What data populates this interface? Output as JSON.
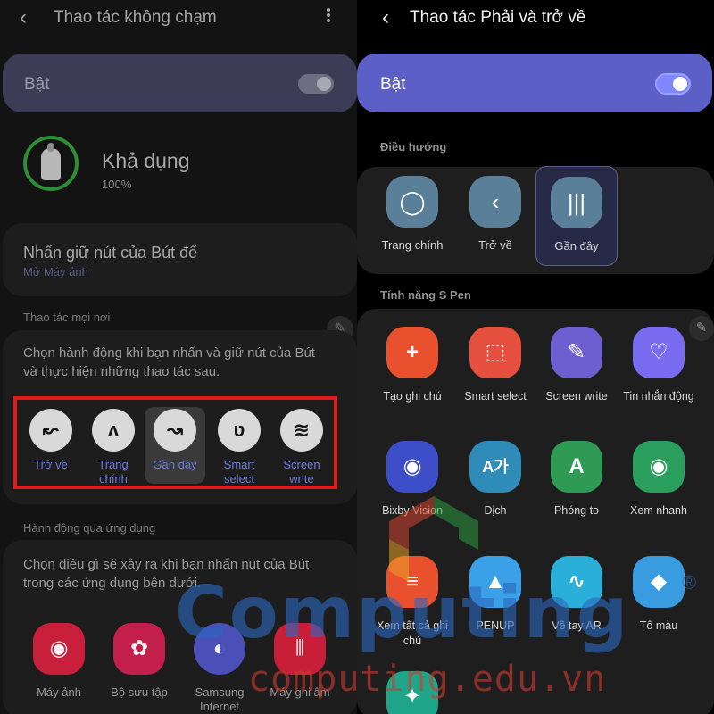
{
  "left_screen": {
    "title": "Thao tác không chạm",
    "toggle_label": "Bật",
    "battery": {
      "status": "Khả dụng",
      "percent": "100%"
    },
    "press_hold": {
      "title": "Nhấn giữ nút của Bút để",
      "value": "Mở Máy ảnh"
    },
    "section_anywhere": "Thao tác mọi nơi",
    "anywhere_desc": "Chọn hành động khi bạn nhấn và giữ nút của Bút và thực hiện những thao tác sau.",
    "gestures": [
      {
        "label": "Trở về",
        "icon": "gesture-back-icon",
        "glyph": "↜"
      },
      {
        "label": "Trang chính",
        "icon": "gesture-home-icon",
        "glyph": "ʌ"
      },
      {
        "label": "Gần đây",
        "icon": "gesture-recent-icon",
        "glyph": "↝"
      },
      {
        "label": "Smart select",
        "icon": "gesture-smart-select-icon",
        "glyph": "ʋ"
      },
      {
        "label": "Screen write",
        "icon": "gesture-screen-write-icon",
        "glyph": "≋"
      }
    ],
    "selected_gesture": "Gần đây",
    "section_app": "Hành động qua ứng dụng",
    "app_desc": "Chọn điều gì sẽ xảy ra khi bạn nhấn nút của Bút trong các ứng dụng bên dưới.",
    "apps": [
      {
        "label": "Máy ảnh",
        "icon": "camera-icon",
        "color": "#c8203b"
      },
      {
        "label": "Bộ sưu tập",
        "icon": "gallery-icon",
        "color": "#c21f4d"
      },
      {
        "label": "Samsung Internet",
        "icon": "samsung-internet-icon",
        "color": "#4b4fb8"
      },
      {
        "label": "Máy ghi âm",
        "icon": "voice-recorder-icon",
        "color": "#c81e38"
      }
    ]
  },
  "right_screen": {
    "title": "Thao tác Phải và trở về",
    "toggle_label": "Bật",
    "section_navigation": "Điều hướng",
    "nav_items": [
      {
        "label": "Trang chính",
        "icon": "home-icon",
        "glyph": "◯"
      },
      {
        "label": "Trở về",
        "icon": "back-icon",
        "glyph": "‹"
      },
      {
        "label": "Gần đây",
        "icon": "recents-icon",
        "glyph": "|||"
      }
    ],
    "selected_nav": "Gần đây",
    "section_features": "Tính năng S Pen",
    "features": [
      {
        "label": "Tạo ghi chú",
        "icon": "create-note-icon",
        "color": "#e8502e",
        "glyph": "+"
      },
      {
        "label": "Smart select",
        "icon": "smart-select-icon",
        "color": "#e4503d",
        "glyph": "⬚"
      },
      {
        "label": "Screen write",
        "icon": "screen-write-icon",
        "color": "#6d5fd0",
        "glyph": "✎"
      },
      {
        "label": "Tin nhắn động",
        "icon": "live-message-icon",
        "color": "#7a6cf0",
        "glyph": "♡"
      },
      {
        "label": "Bixby Vision",
        "icon": "bixby-vision-icon",
        "color": "#3d4fc8",
        "glyph": "◉"
      },
      {
        "label": "Dịch",
        "icon": "translate-icon",
        "color": "#2f8bb8",
        "glyph": "A가"
      },
      {
        "label": "Phóng to",
        "icon": "magnify-icon",
        "color": "#2e9a54",
        "glyph": "A"
      },
      {
        "label": "Xem nhanh",
        "icon": "glance-icon",
        "color": "#2a9e5c",
        "glyph": "◉"
      },
      {
        "label": "Xem tất cả ghi chú",
        "icon": "view-all-notes-icon",
        "color": "#e8502e",
        "glyph": "≡"
      },
      {
        "label": "PENUP",
        "icon": "penup-icon",
        "color": "#3aa0e8",
        "glyph": "▲"
      },
      {
        "label": "Vẽ tay AR",
        "icon": "ar-doodle-icon",
        "color": "#2ab0d8",
        "glyph": "∿"
      },
      {
        "label": "Tô màu",
        "icon": "coloring-icon",
        "color": "#3a9ce0",
        "glyph": "◆"
      },
      {
        "label": "",
        "icon": "ar-emoji-icon",
        "color": "#1fa68a",
        "glyph": "✦"
      }
    ]
  },
  "watermark": {
    "brand": "Computing",
    "registered": "®",
    "url": "computing.edu.vn"
  },
  "colors": {
    "accent": "#5b5fc6",
    "gesture_label": "#6f79d8",
    "highlight_border": "#e11b1b"
  }
}
